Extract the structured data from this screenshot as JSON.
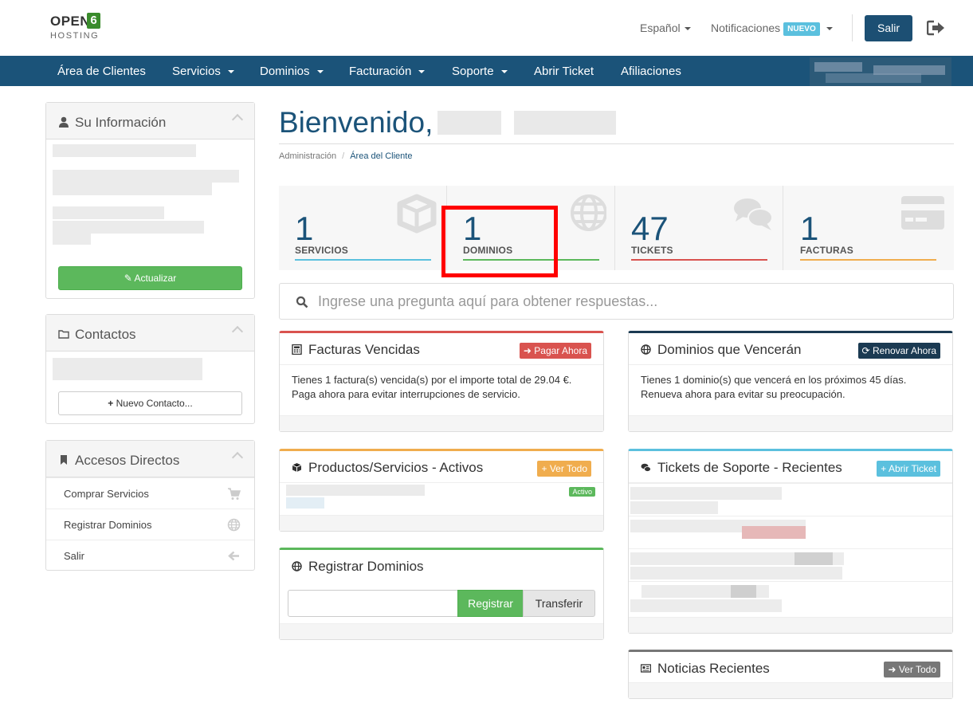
{
  "header": {
    "logo": {
      "top": "OPEN",
      "digit": "6",
      "bottom": "HOSTING"
    },
    "language": "Español",
    "notifications": "Notificaciones",
    "new_badge": "NUEVO",
    "logout_button": "Salir"
  },
  "nav": {
    "items": [
      "Área de Clientes",
      "Servicios",
      "Dominios",
      "Facturación",
      "Soporte",
      "Abrir Ticket",
      "Afiliaciones"
    ]
  },
  "sidebar": {
    "info": {
      "title": "Su Información",
      "button": "Actualizar"
    },
    "contacts": {
      "title": "Contactos",
      "button": "Nuevo Contacto..."
    },
    "shortcuts": {
      "title": "Accesos Directos",
      "items": [
        "Comprar Servicios",
        "Registrar Dominios",
        "Salir"
      ]
    }
  },
  "main": {
    "welcome": "Bienvenido,",
    "breadcrumb": [
      "Administración",
      "Área del Cliente"
    ],
    "tiles": [
      {
        "value": "1",
        "label": "SERVICIOS",
        "color": "#5bc0de"
      },
      {
        "value": "1",
        "label": "DOMINIOS",
        "color": "#5cb85c"
      },
      {
        "value": "47",
        "label": "TICKETS",
        "color": "#d9534f"
      },
      {
        "value": "1",
        "label": "FACTURAS",
        "color": "#f0ad4e"
      }
    ],
    "search_placeholder": "Ingrese una pregunta aquí para obtener respuestas...",
    "overdue": {
      "title": "Facturas Vencidas",
      "button": "Pagar Ahora",
      "line1": "Tienes 1 factura(s) vencida(s) por el importe total de 29.04 €.",
      "line2": "Paga ahora para evitar interrupciones de servicio."
    },
    "expiring": {
      "title": "Dominios que Vencerán",
      "button": "Renovar Ahora",
      "line1": "Tienes 1 dominio(s) que vencerá en los próximos 45 días.",
      "line2": "Renueva ahora para evitar su preocupación."
    },
    "products": {
      "title": "Productos/Servicios - Activos",
      "button": "Ver Todo",
      "status": "Activo"
    },
    "tickets": {
      "title": "Tickets de Soporte - Recientes",
      "button": "Abrir Ticket"
    },
    "register": {
      "title": "Registrar Dominios",
      "register_button": "Registrar",
      "transfer_button": "Transferir"
    },
    "news": {
      "title": "Noticias Recientes",
      "button": "Ver Todo"
    }
  },
  "colors": {
    "brand": "#1b5379",
    "success": "#5cb85c",
    "danger": "#d9534f",
    "info": "#5bc0de",
    "warning": "#f0ad4e"
  }
}
